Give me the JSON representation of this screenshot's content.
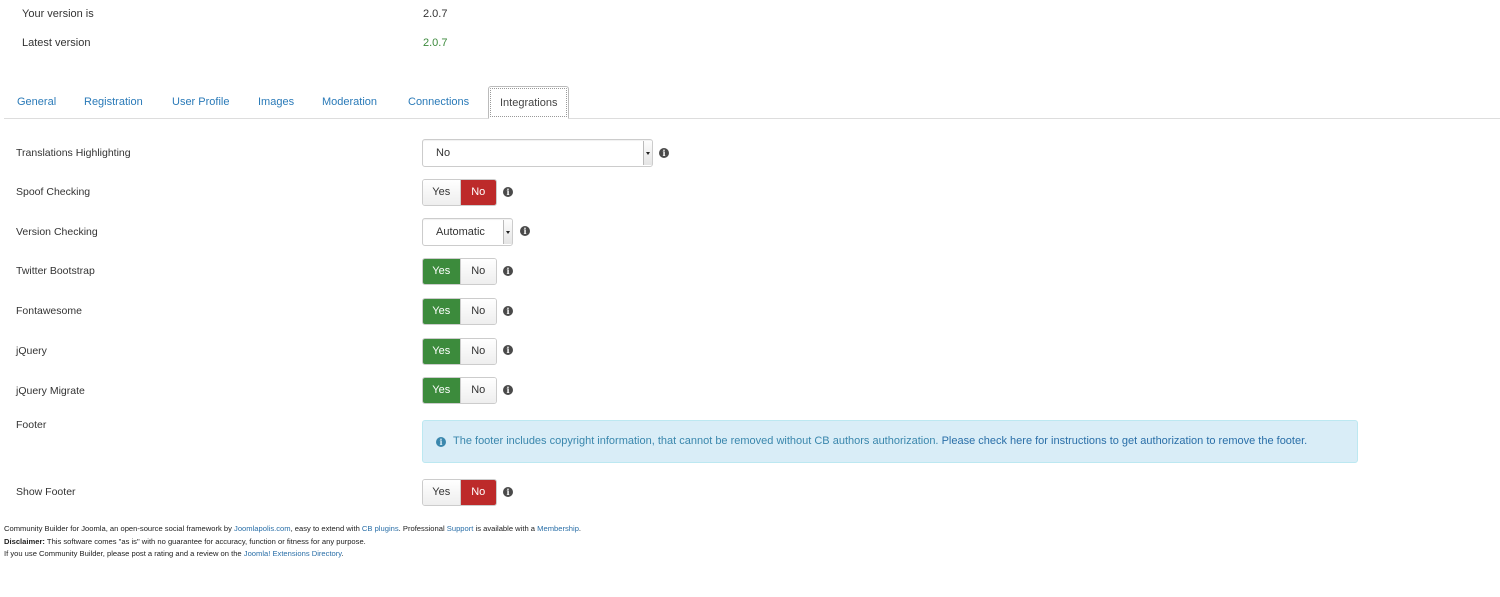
{
  "version": {
    "current_label": "Your version is",
    "current_value": "2.0.7",
    "latest_label": "Latest version",
    "latest_value": "2.0.7"
  },
  "tabs": [
    {
      "label": "General"
    },
    {
      "label": "Registration"
    },
    {
      "label": "User Profile"
    },
    {
      "label": "Images"
    },
    {
      "label": "Moderation"
    },
    {
      "label": "Connections"
    },
    {
      "label": "Integrations",
      "active": true
    }
  ],
  "settings": {
    "translations_highlighting": {
      "label": "Translations Highlighting",
      "value": "No"
    },
    "spoof_checking": {
      "label": "Spoof Checking",
      "yes": "Yes",
      "no": "No",
      "selected": "No"
    },
    "version_checking": {
      "label": "Version Checking",
      "value": "Automatic"
    },
    "twitter_bootstrap": {
      "label": "Twitter Bootstrap",
      "yes": "Yes",
      "no": "No",
      "selected": "Yes"
    },
    "fontawesome": {
      "label": "Fontawesome",
      "yes": "Yes",
      "no": "No",
      "selected": "Yes"
    },
    "jquery": {
      "label": "jQuery",
      "yes": "Yes",
      "no": "No",
      "selected": "Yes"
    },
    "jquery_migrate": {
      "label": "jQuery Migrate",
      "yes": "Yes",
      "no": "No",
      "selected": "Yes"
    },
    "footer": {
      "label": "Footer",
      "notice_text": "The footer includes copyright information, that cannot be removed without CB authors authorization. ",
      "notice_link": "Please check here for instructions to get authorization to remove the footer."
    },
    "show_footer": {
      "label": "Show Footer",
      "yes": "Yes",
      "no": "No",
      "selected": "No"
    }
  },
  "info_icon_glyph": "i",
  "page_footer": {
    "line1_a": "Community Builder for Joomla, an open-source social framework by ",
    "line1_link1": "Joomlapolis.com",
    "line1_b": ", easy to extend with ",
    "line1_link2": "CB plugins",
    "line1_c": ". Professional ",
    "line1_link3": "Support",
    "line1_d": " is available with a ",
    "line1_link4": "Membership",
    "line1_e": ".",
    "disclaimer_label": "Disclaimer:",
    "disclaimer_text": " This software comes \"as is\" with no guarantee for accuracy, function or fitness for any purpose.",
    "line3_a": "If you use Community Builder, please post a rating and a review on the ",
    "line3_link": "Joomla! Extensions Directory",
    "line3_b": "."
  },
  "colors": {
    "link": "#2a7ab8",
    "yes_active": "#3c8b3c",
    "no_active": "#bd2a2a",
    "alert_bg": "#d9edf7",
    "alert_text": "#3a87ad",
    "latest_version": "#3c8a3c"
  }
}
